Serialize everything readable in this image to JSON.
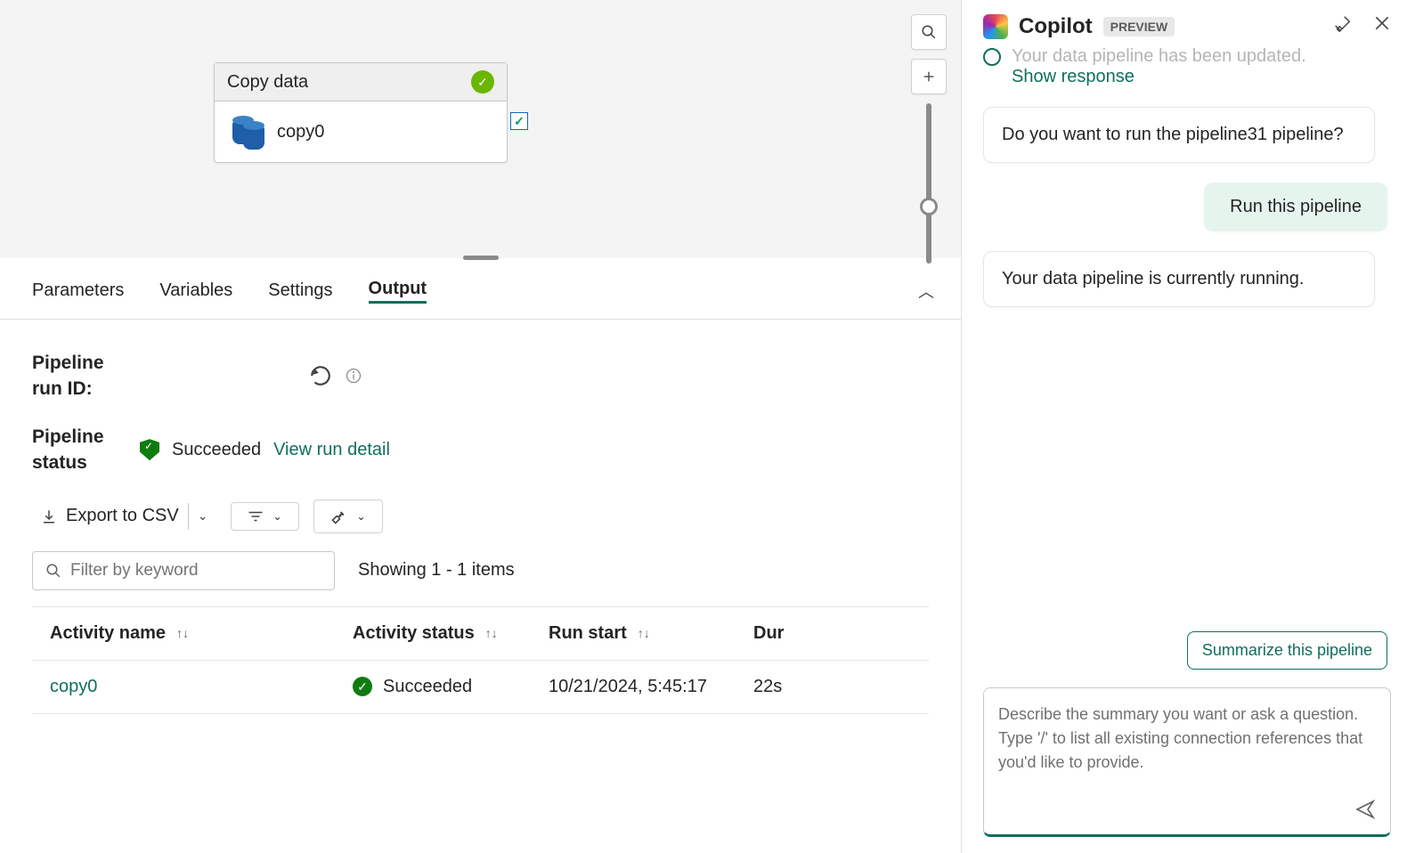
{
  "canvas": {
    "activity": {
      "type_label": "Copy data",
      "name": "copy0"
    }
  },
  "tabs": {
    "parameters": "Parameters",
    "variables": "Variables",
    "settings": "Settings",
    "output": "Output"
  },
  "output": {
    "run_id_label": "Pipeline run ID:",
    "status_label": "Pipeline status",
    "status_value": "Succeeded",
    "view_run_link": "View run detail",
    "export_label": "Export to CSV",
    "filter_placeholder": "Filter by keyword",
    "count_text": "Showing 1 - 1 items",
    "columns": {
      "name": "Activity name",
      "status": "Activity status",
      "start": "Run start",
      "duration": "Dur"
    },
    "rows": [
      {
        "name": "copy0",
        "status": "Succeeded",
        "start": "10/21/2024, 5:45:17",
        "duration": "22s"
      }
    ]
  },
  "copilot": {
    "title": "Copilot",
    "badge": "PREVIEW",
    "cutoff_text": "Your data pipeline has been updated.",
    "show_response": "Show response",
    "msg_prompt": "Do you want to run the pipeline31 pipeline?",
    "msg_user": "Run this pipeline",
    "msg_running": "Your data pipeline is currently running.",
    "suggestion": "Summarize this pipeline",
    "input_placeholder": "Describe the summary you want or ask a question.\nType '/' to list all existing connection references that you'd like to provide."
  }
}
